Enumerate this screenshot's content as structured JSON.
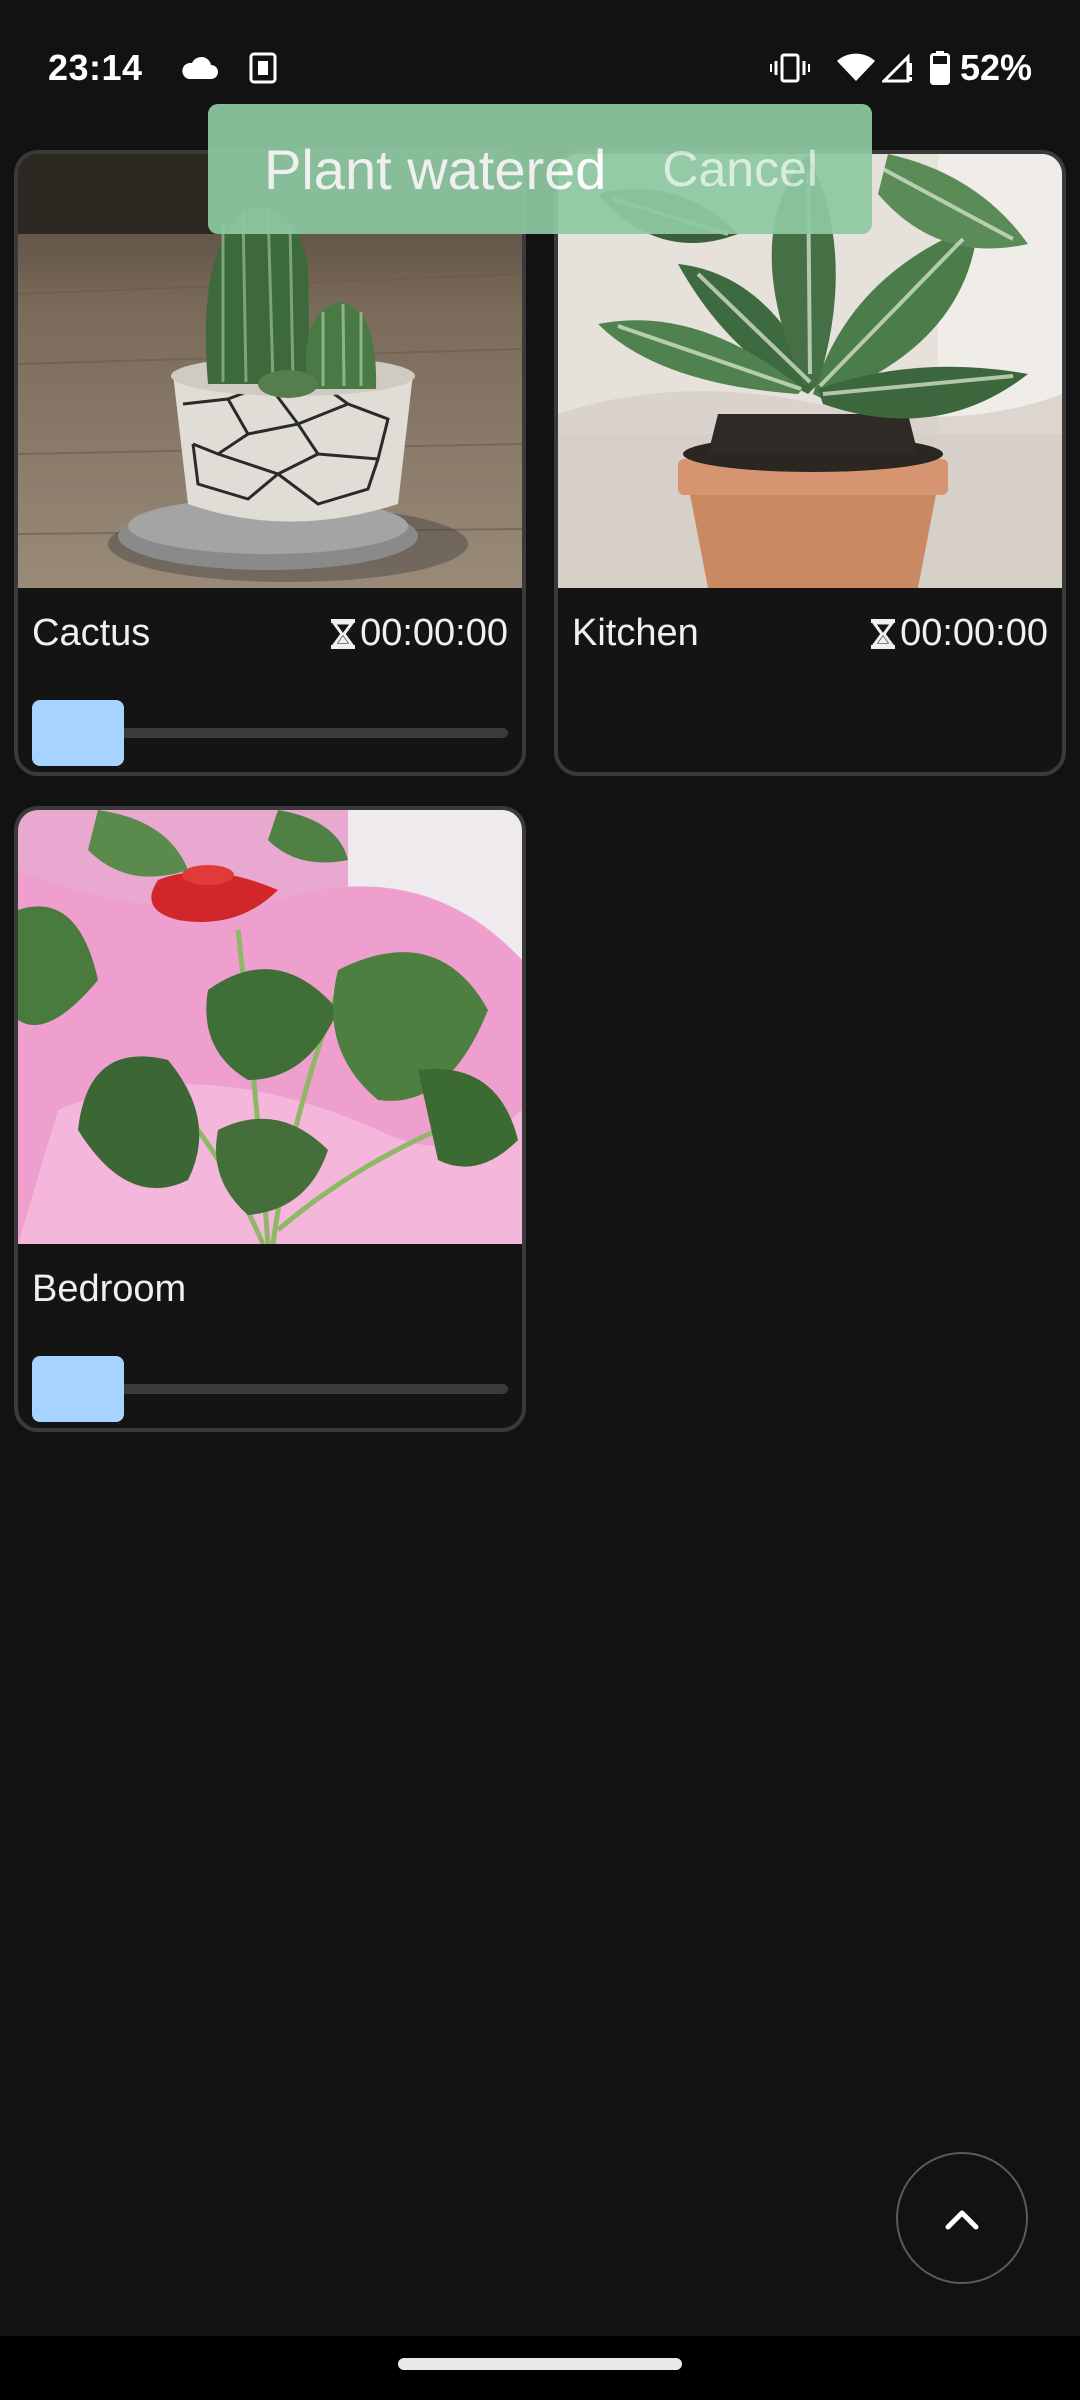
{
  "status_bar": {
    "time": "23:14",
    "battery": "52%",
    "icons": [
      "cloud-icon",
      "sim-card-icon",
      "vibrate-icon",
      "wifi-icon",
      "cell-signal-icon",
      "battery-icon"
    ]
  },
  "snackbar": {
    "message": "Plant watered",
    "action": "Cancel",
    "color": "#8ec9a2"
  },
  "plants": [
    {
      "name": "Cactus",
      "timer": "00:00:00",
      "show_timer": true,
      "show_slider": true,
      "slider_value": 0,
      "photo": "cactus-photo"
    },
    {
      "name": "Kitchen",
      "timer": "00:00:00",
      "show_timer": true,
      "show_slider": false,
      "photo": "calathea-photo"
    },
    {
      "name": "Bedroom",
      "timer": "",
      "show_timer": false,
      "show_slider": true,
      "slider_value": 0,
      "photo": "anthurium-photo"
    }
  ],
  "fab": {
    "icon": "chevron-up-icon"
  },
  "colors": {
    "background": "#121212",
    "card_border": "#3a3a3a",
    "slider_thumb": "#a6d3ff",
    "slider_track": "#3b3b3b"
  }
}
